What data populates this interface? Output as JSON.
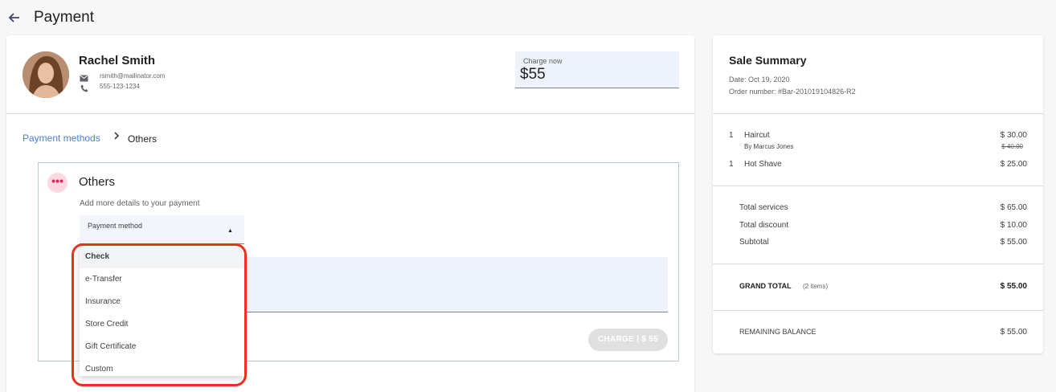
{
  "header": {
    "title": "Payment",
    "back_icon": "arrow-left-icon"
  },
  "customer": {
    "name": "Rachel Smith",
    "email": "rsmith@mailinator.com",
    "phone": "555-123-1234"
  },
  "charge": {
    "label": "Charge now",
    "currency": "$",
    "amount": "55"
  },
  "breadcrumb": {
    "parent": "Payment methods",
    "current": "Others"
  },
  "others": {
    "title": "Others",
    "subtitle": "Add more details to your payment",
    "select_label": "Payment method",
    "options": [
      "Check",
      "e-Transfer",
      "Insurance",
      "Store Credit",
      "Gift Certificate",
      "Custom"
    ],
    "charge_button": "CHARGE | $ 55"
  },
  "summary": {
    "title": "Sale Summary",
    "date": "Date: Oct 19, 2020",
    "order": "Order number: #Bar-201019104826-R2",
    "items": [
      {
        "qty": "1",
        "name": "Haircut",
        "by": "By Marcus Jones",
        "price": "$ 30.00",
        "old_price": "$ 40.00"
      },
      {
        "qty": "1",
        "name": "Hot Shave",
        "price": "$ 25.00"
      }
    ],
    "totals": [
      {
        "label": "Total services",
        "value": "$ 65.00"
      },
      {
        "label": "Total discount",
        "value": "$ 10.00"
      },
      {
        "label": "Subtotal",
        "value": "$ 55.00"
      }
    ],
    "grand_total_label": "GRAND TOTAL",
    "grand_total_items": "(2 items)",
    "grand_total_value": "$ 55.00",
    "remaining_label": "REMAINING BALANCE",
    "remaining_value": "$ 55.00"
  },
  "colors": {
    "link": "#4a7fd1",
    "highlight": "#e8321d",
    "accent_pink": "#e0245e"
  }
}
